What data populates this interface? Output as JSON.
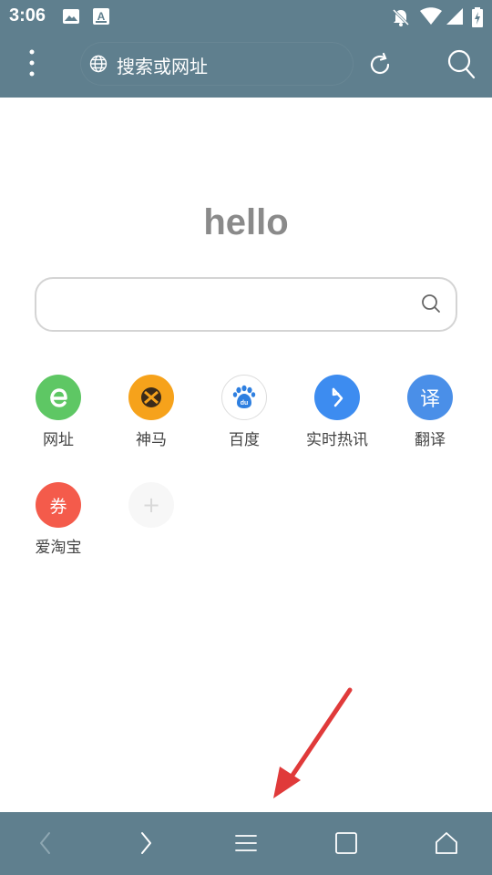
{
  "status_bar": {
    "time": "3:06",
    "left_icons": [
      "image-icon",
      "text-a-icon"
    ],
    "right_icons": [
      "notifications-off-icon",
      "wifi-icon",
      "cell-signal-icon",
      "battery-charging-icon"
    ]
  },
  "toolbar": {
    "menu_icon": "more-vert-icon",
    "url_placeholder": "搜索或网址",
    "refresh_icon": "refresh-icon",
    "search_icon": "search-icon"
  },
  "home": {
    "greeting": "hello",
    "search_placeholder": ""
  },
  "shortcuts": [
    {
      "label": "网址",
      "glyph": "e",
      "color": "#5ec764",
      "icon": "ie-e-icon"
    },
    {
      "label": "神马",
      "glyph": "",
      "color": "#f6a21b",
      "icon": "shenma-icon"
    },
    {
      "label": "百度",
      "glyph": "du",
      "color": "#ffffff",
      "icon": "baidu-paw-icon"
    },
    {
      "label": "实时热讯",
      "glyph": "",
      "color": "#3d8cf0",
      "icon": "hot-news-icon"
    },
    {
      "label": "翻译",
      "glyph": "译",
      "color": "#4a8fe8",
      "icon": "translate-icon"
    },
    {
      "label": "爱淘宝",
      "glyph": "券",
      "color": "#f45b4b",
      "icon": "coupon-icon"
    },
    {
      "label": "",
      "glyph": "+",
      "color": "#f7f7f7",
      "icon": "add-shortcut-icon"
    }
  ],
  "bottom_nav": {
    "buttons": [
      "back-icon",
      "forward-icon",
      "menu-icon",
      "tabs-icon",
      "home-icon"
    ]
  },
  "colors": {
    "chrome": "#5f7f8e",
    "annotation_arrow": "#e03a3a"
  }
}
